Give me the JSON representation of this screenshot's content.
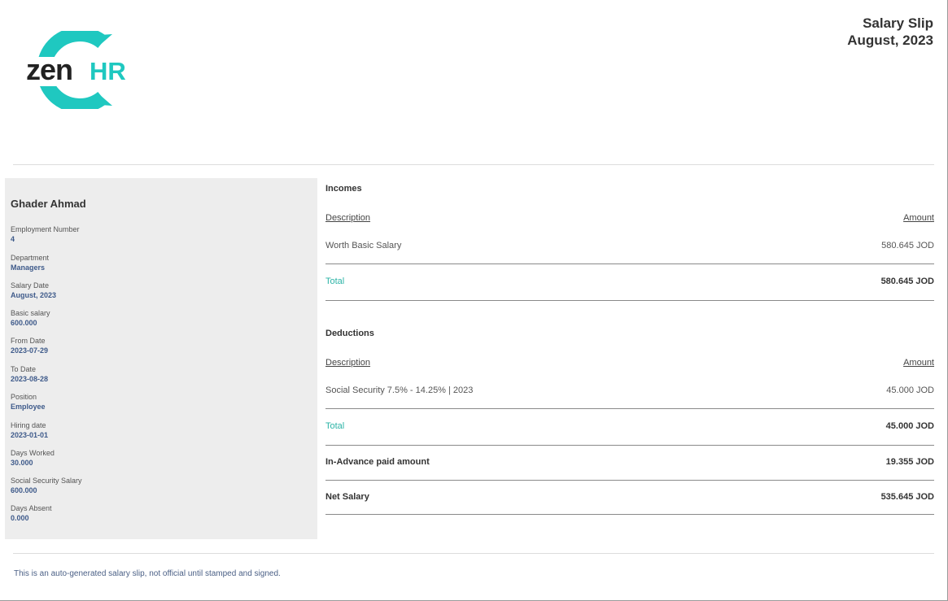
{
  "brand": {
    "logo_text_dark": "zen",
    "logo_text_accent": "HR",
    "accent_color": "#1fc8c0",
    "dark_color": "#222222"
  },
  "header": {
    "title": "Salary Slip",
    "period": "August, 2023"
  },
  "employee": {
    "name": "Ghader Ahmad",
    "fields": [
      {
        "label": "Employment Number",
        "value": "4"
      },
      {
        "label": "Department",
        "value": "Managers"
      },
      {
        "label": "Salary Date",
        "value": "August, 2023"
      },
      {
        "label": "Basic salary",
        "value": "600.000"
      },
      {
        "label": "From Date",
        "value": "2023-07-29"
      },
      {
        "label": "To Date",
        "value": "2023-08-28"
      },
      {
        "label": "Position",
        "value": "Employee"
      },
      {
        "label": "Hiring date",
        "value": "2023-01-01"
      },
      {
        "label": "Days Worked",
        "value": "30.000"
      },
      {
        "label": "Social Security Salary",
        "value": "600.000"
      },
      {
        "label": "Days Absent",
        "value": "0.000"
      }
    ]
  },
  "incomes": {
    "title": "Incomes",
    "col_description": "Description",
    "col_amount": "Amount",
    "items": [
      {
        "description": "Worth Basic Salary",
        "amount": "580.645 JOD"
      }
    ],
    "total_label": "Total",
    "total_value": "580.645 JOD"
  },
  "deductions": {
    "title": "Deductions",
    "col_description": "Description",
    "col_amount": "Amount",
    "items": [
      {
        "description": "Social Security 7.5% - 14.25% | 2023",
        "amount": "45.000 JOD"
      }
    ],
    "total_label": "Total",
    "total_value": "45.000 JOD"
  },
  "advance": {
    "label": "In-Advance paid amount",
    "value": "19.355 JOD"
  },
  "net": {
    "label": "Net Salary",
    "value": "535.645 JOD"
  },
  "footer": {
    "note": "This is an auto-generated salary slip, not official until stamped and signed."
  }
}
